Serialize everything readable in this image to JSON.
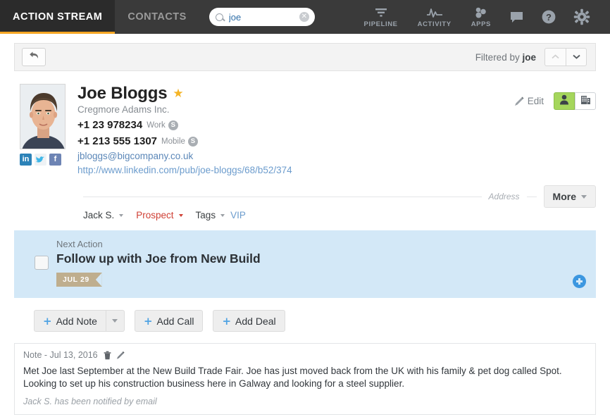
{
  "topnav": {
    "tabs": [
      {
        "label": "ACTION STREAM",
        "active": true
      },
      {
        "label": "CONTACTS",
        "active": false
      }
    ],
    "search": {
      "value": "joe",
      "placeholder": "Search",
      "icon": "search-icon",
      "clear_icon": "clear-circle-icon"
    },
    "right_items": [
      {
        "label": "PIPELINE",
        "icon": "funnel-icon"
      },
      {
        "label": "ACTIVITY",
        "icon": "pulse-icon"
      },
      {
        "label": "APPS",
        "icon": "apps-icon"
      }
    ],
    "plain_icons": [
      {
        "icon": "chat-bubble-icon"
      },
      {
        "icon": "help-circle-icon"
      },
      {
        "icon": "gear-icon"
      }
    ],
    "accent_color": "#f5a623",
    "bg_color": "#3a3a3a"
  },
  "filterbar": {
    "back_icon": "back-arrow-icon",
    "filtered_prefix": "Filtered by",
    "filtered_term": "joe",
    "up_icon": "chevron-up-icon",
    "down_icon": "chevron-down-icon"
  },
  "contact": {
    "avatar": {
      "icon": "contact-photo",
      "alt": "Joe Bloggs photo"
    },
    "name": "Joe Bloggs",
    "star_icon": "star-icon",
    "company": "Cregmore Adams Inc.",
    "phones": [
      {
        "number": "+1 23 978234",
        "type": "Work",
        "skype_icon": "skype-icon"
      },
      {
        "number": "+1 213 555 1307",
        "type": "Mobile",
        "skype_icon": "skype-icon"
      }
    ],
    "email": "jbloggs@bigcompany.co.uk",
    "website": "http://www.linkedin.com/pub/joe-bloggs/68/b52/374",
    "social": [
      {
        "name": "linkedin-icon",
        "label": "in"
      },
      {
        "name": "twitter-icon",
        "label": ""
      },
      {
        "name": "facebook-icon",
        "label": "f"
      }
    ],
    "edit_label": "Edit",
    "edit_icon": "pencil-icon",
    "view_toggle": [
      {
        "icon": "person-icon",
        "active": true
      },
      {
        "icon": "building-icon",
        "active": false
      }
    ],
    "divider_label": "Address",
    "more_label": "More",
    "meta": [
      {
        "label": "Jack S.",
        "style": "normal",
        "caret": true
      },
      {
        "label": "Prospect",
        "style": "red",
        "caret": true
      },
      {
        "label": "Tags",
        "style": "normal",
        "caret": true
      }
    ],
    "tag_value": "VIP"
  },
  "next_action": {
    "eyebrow": "Next Action",
    "title": "Follow up with Joe from New Build",
    "date_badge": "JUL 29",
    "checkbox_name": "complete-checkbox",
    "add_icon": "plus-circle-icon",
    "bg_color": "#d3e8f7",
    "badge_color": "#bfae8e"
  },
  "add_buttons": [
    {
      "label": "Add Note",
      "has_split": true
    },
    {
      "label": "Add Call",
      "has_split": false
    },
    {
      "label": "Add Deal",
      "has_split": false
    }
  ],
  "note": {
    "heading": "Note - Jul 13, 2016",
    "delete_icon": "trash-icon",
    "edit_icon": "pencil-icon",
    "body": "Met Joe last September at the New Build Trade Fair. Joe has just moved back from the UK with his family & pet dog called Spot. Looking to set up his construction business here in Galway and looking for a steel supplier.",
    "footer": "Jack S. has been notified by email"
  }
}
